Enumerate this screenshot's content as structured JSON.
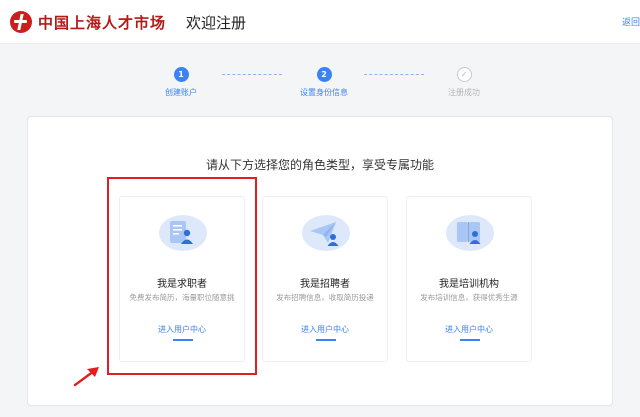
{
  "header": {
    "logo_text": "中国上海人才市场",
    "title": "欢迎注册",
    "right_link": "返回"
  },
  "steps": [
    {
      "number": "1",
      "label": "创建账户",
      "state": "done"
    },
    {
      "number": "2",
      "label": "设置身份信息",
      "state": "current"
    },
    {
      "number": "",
      "label": "注册成功",
      "state": "pending"
    }
  ],
  "main": {
    "prompt": "请从下方选择您的角色类型，享受专属功能",
    "cards": [
      {
        "name": "我是求职者",
        "desc": "免费发布简历，海量职位随意挑",
        "link": "进入用户中心",
        "icon": "resume-user-icon"
      },
      {
        "name": "我是招聘者",
        "desc": "发布招聘信息，收取简历投递",
        "link": "进入用户中心",
        "icon": "send-plane-user-icon"
      },
      {
        "name": "我是培训机构",
        "desc": "发布培训信息，获得优秀生源",
        "link": "进入用户中心",
        "icon": "book-user-icon"
      }
    ]
  },
  "colors": {
    "accent": "#3b82f6",
    "brand": "#c8201d",
    "annotation": "#e02020"
  }
}
